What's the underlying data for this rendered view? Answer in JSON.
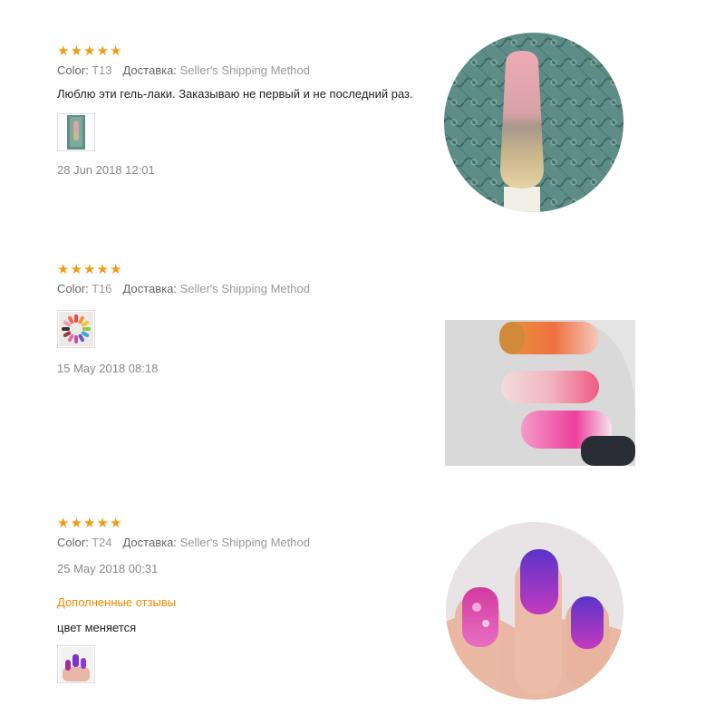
{
  "reviews": [
    {
      "rating": 5,
      "color_label": "Color:",
      "color_value": "T13",
      "shipping_label": "Доставка:",
      "shipping_value": "Seller's Shipping Method",
      "text": "Люблю эти гель-лаки. Заказываю не первый и не последний раз.",
      "date": "28 Jun 2018 12:01"
    },
    {
      "rating": 5,
      "color_label": "Color:",
      "color_value": "T16",
      "shipping_label": "Доставка:",
      "shipping_value": "Seller's Shipping Method",
      "date": "15 May 2018 08:18"
    },
    {
      "rating": 5,
      "color_label": "Color:",
      "color_value": "T24",
      "shipping_label": "Доставка:",
      "shipping_value": "Seller's Shipping Method",
      "date": "25 May 2018 00:31",
      "additional_title": "Дополненные отзывы",
      "additional_text": "цвет меняется"
    }
  ],
  "colors": {
    "star": "#f59a10",
    "additional_title": "#f08a00",
    "meta_label": "#666666",
    "meta_value": "#999999"
  }
}
